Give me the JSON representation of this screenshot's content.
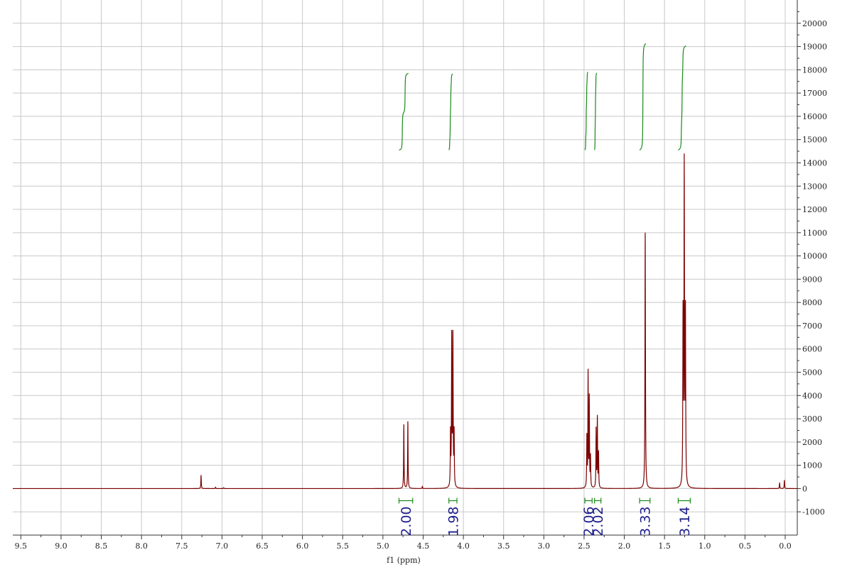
{
  "chart_data": {
    "type": "line",
    "xlabel": "f1 (ppm)",
    "x_axis": {
      "range": [
        9.6,
        -0.15
      ],
      "reversed": true,
      "ticks": [
        9.5,
        9.0,
        8.5,
        8.0,
        7.5,
        7.0,
        6.5,
        6.0,
        5.5,
        5.0,
        4.5,
        4.0,
        3.5,
        3.0,
        2.5,
        2.0,
        1.5,
        1.0,
        0.5,
        0.0
      ],
      "tick_labels": [
        "9.5",
        "9.0",
        "8.5",
        "8.0",
        "7.5",
        "7.0",
        "6.5",
        "6.0",
        "5.5",
        "5.0",
        "4.5",
        "4.0",
        "3.5",
        "3.0",
        "2.5",
        "2.0",
        "1.5",
        "1.0",
        "0.5",
        "0.0"
      ]
    },
    "y_axis": {
      "position": "right",
      "range": [
        -2000,
        21000
      ],
      "ticks": [
        -1000,
        0,
        1000,
        2000,
        3000,
        4000,
        5000,
        6000,
        7000,
        8000,
        9000,
        10000,
        11000,
        12000,
        13000,
        14000,
        15000,
        16000,
        17000,
        18000,
        19000,
        20000
      ],
      "tick_labels": [
        "-1000",
        "0",
        "1000",
        "2000",
        "3000",
        "4000",
        "5000",
        "6000",
        "7000",
        "8000",
        "9000",
        "10000",
        "11000",
        "12000",
        "13000",
        "14000",
        "15000",
        "16000",
        "17000",
        "18000",
        "19000",
        "20000"
      ]
    },
    "grid": true,
    "colors": {
      "spectrum": "#7b0000",
      "integral_curve": "#1a8a1a",
      "integral_label": "#1e1e8c",
      "grid": "#c8c8c8"
    },
    "peaks": [
      {
        "ppm": 7.26,
        "height": 580
      },
      {
        "ppm": 7.08,
        "height": 60
      },
      {
        "ppm": 6.98,
        "height": 40
      },
      {
        "ppm": 4.74,
        "height": 2750
      },
      {
        "ppm": 4.69,
        "height": 2880
      },
      {
        "ppm": 4.51,
        "height": 90
      },
      {
        "ppm": 4.16,
        "height": 2250
      },
      {
        "ppm": 4.145,
        "height": 6380
      },
      {
        "ppm": 4.13,
        "height": 6380
      },
      {
        "ppm": 4.115,
        "height": 2250
      },
      {
        "ppm": 2.465,
        "height": 2150
      },
      {
        "ppm": 2.45,
        "height": 4900
      },
      {
        "ppm": 2.435,
        "height": 3820
      },
      {
        "ppm": 2.42,
        "height": 1300
      },
      {
        "ppm": 2.35,
        "height": 2520
      },
      {
        "ppm": 2.335,
        "height": 3000
      },
      {
        "ppm": 2.32,
        "height": 1500
      },
      {
        "ppm": 1.74,
        "height": 11000
      },
      {
        "ppm": 1.27,
        "height": 7300
      },
      {
        "ppm": 1.255,
        "height": 13650
      },
      {
        "ppm": 1.24,
        "height": 7300
      },
      {
        "ppm": 0.07,
        "height": 240
      },
      {
        "ppm": 0.01,
        "height": 360
      }
    ],
    "integrals": [
      {
        "label": "2.00",
        "from": 4.8,
        "to": 4.63
      },
      {
        "label": "1.98",
        "from": 4.18,
        "to": 4.08
      },
      {
        "label": "2.06",
        "from": 2.49,
        "to": 2.4
      },
      {
        "label": "2.02",
        "from": 2.37,
        "to": 2.29
      },
      {
        "label": "3.33",
        "from": 1.81,
        "to": 1.68
      },
      {
        "label": "3.14",
        "from": 1.33,
        "to": 1.18
      }
    ]
  }
}
